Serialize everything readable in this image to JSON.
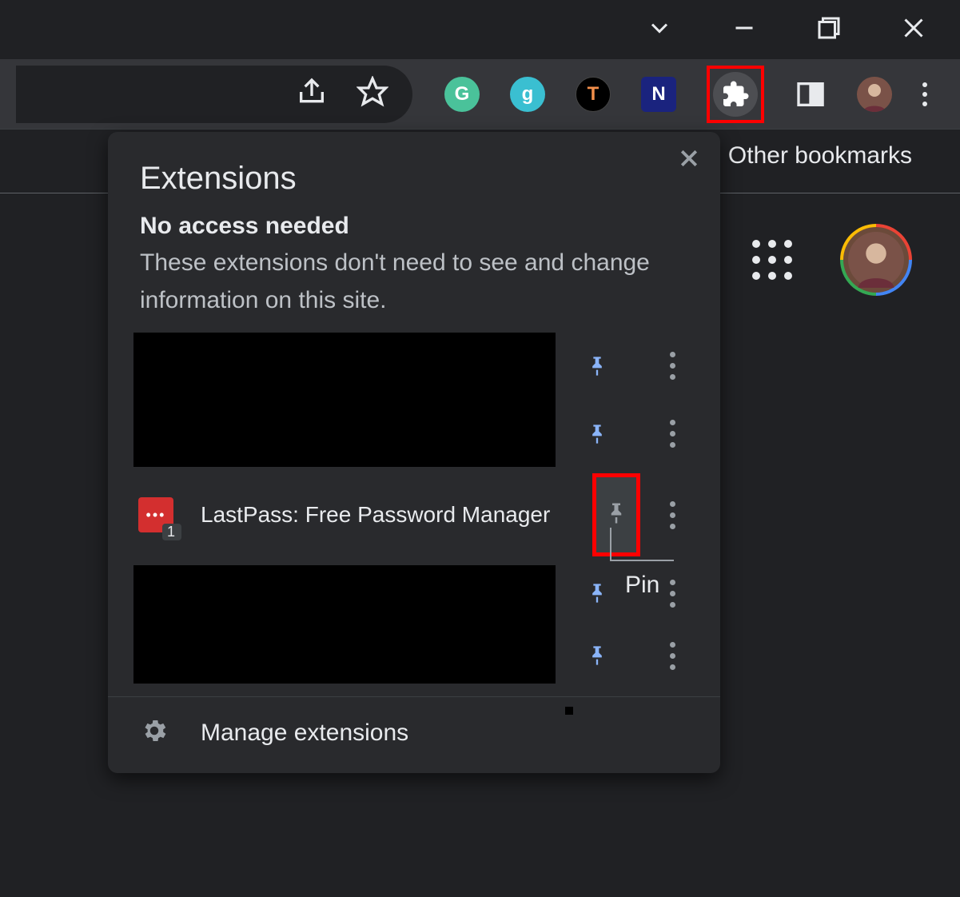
{
  "window": {
    "tab_chevron": "v"
  },
  "toolbar": {},
  "bookmarks": {
    "other_bookmarks": "Other bookmarks"
  },
  "popup": {
    "title": "Extensions",
    "section_heading": "No access needed",
    "section_desc": "These extensions don't need to see and change information on this site.",
    "items": [
      {
        "name": "",
        "pinned": true
      },
      {
        "name": "",
        "pinned": true
      },
      {
        "name": "LastPass: Free Password Manager",
        "badge": "1",
        "pinned": false
      },
      {
        "name": "",
        "pinned": true
      },
      {
        "name": "",
        "pinned": true
      }
    ],
    "pin_tooltip": "Pin",
    "manage_label": "Manage extensions"
  }
}
